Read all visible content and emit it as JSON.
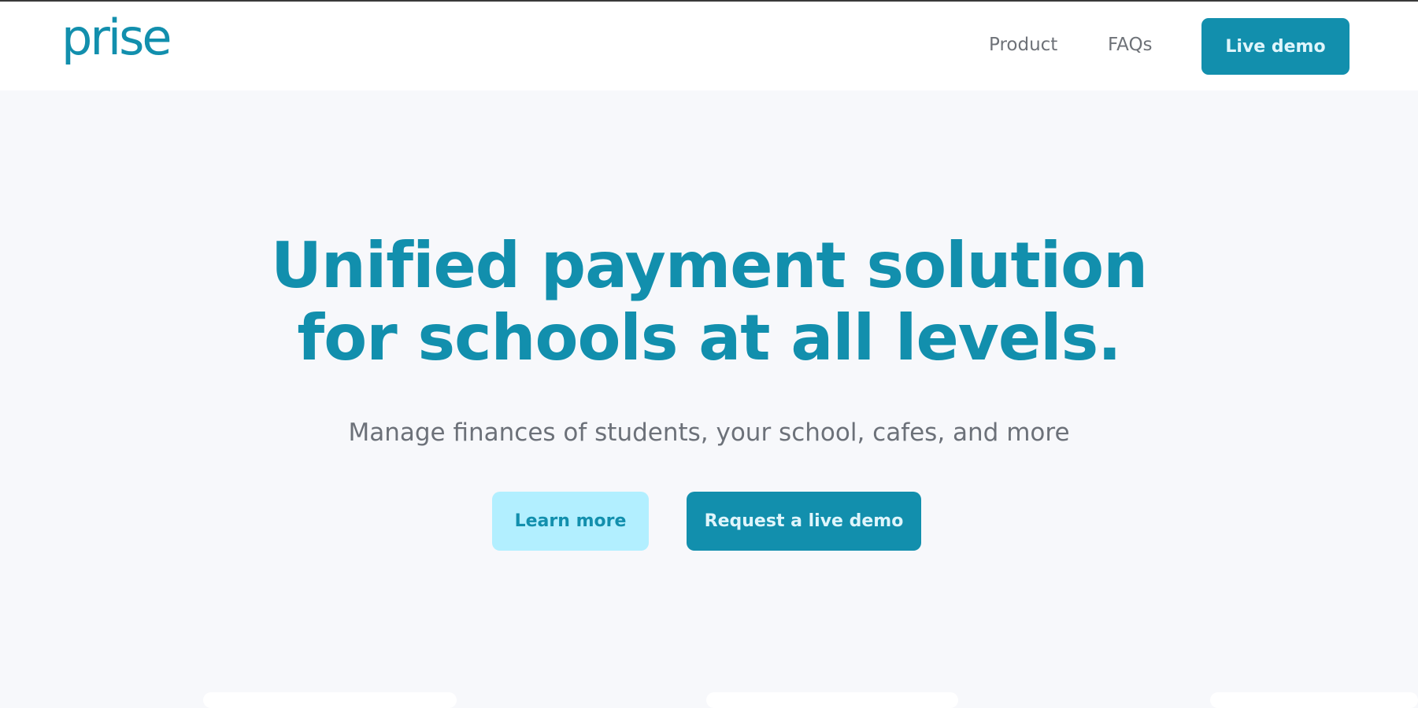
{
  "header": {
    "logo_text": "prise",
    "nav": {
      "product_label": "Product",
      "faqs_label": "FAQs"
    },
    "live_demo_label": "Live demo"
  },
  "hero": {
    "title_line1": "Unified payment solution",
    "title_line2": "for schools at all levels.",
    "subtitle": "Manage finances of students, your school, cafes, and more",
    "learn_more_label": "Learn more",
    "request_demo_label": "Request a live demo"
  },
  "colors": {
    "brand": "#128fad",
    "light_accent": "#b2efff",
    "background": "#f7f8fb",
    "nav_text": "#6e7278"
  }
}
